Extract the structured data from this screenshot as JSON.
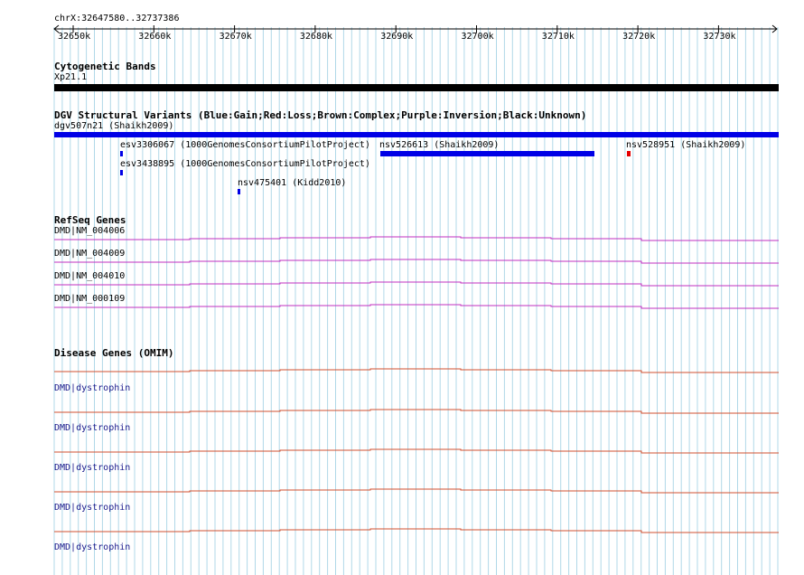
{
  "colors": {
    "grid": "#b0d8e8",
    "gain": "#0000e6",
    "loss": "#e60000",
    "band": "#000000",
    "refseq_line": "#c030c0",
    "omim_line": "#d05030",
    "omim_label": "#1a1a8c"
  },
  "ruler": {
    "location": "chrX:32647580..32737386",
    "ticks": [
      "32650k",
      "32660k",
      "32670k",
      "32680k",
      "32690k",
      "32700k",
      "32710k",
      "32720k",
      "32730k"
    ]
  },
  "cytoband": {
    "title": "Cytogenetic Bands",
    "band_label": "Xp21.1"
  },
  "dgv": {
    "title": "DGV Structural Variants (Blue:Gain;Red:Loss;Brown:Complex;Purple:Inversion;Black:Unknown)",
    "features": [
      {
        "label": "dgv507n21 (Shaikh2009)",
        "type": "gain"
      },
      {
        "label": "esv3306067 (1000GenomesConsortiumPilotProject)",
        "type": "gain"
      },
      {
        "label": "nsv526613 (Shaikh2009)",
        "type": "gain"
      },
      {
        "label": "nsv528951 (Shaikh2009)",
        "type": "loss"
      },
      {
        "label": "esv3438895 (1000GenomesConsortiumPilotProject)",
        "type": "gain"
      },
      {
        "label": "nsv475401 (Kidd2010)",
        "type": "gain"
      }
    ]
  },
  "refseq": {
    "title": "RefSeq Genes",
    "genes": [
      {
        "label": "DMD|NM_004006"
      },
      {
        "label": "DMD|NM_004009"
      },
      {
        "label": "DMD|NM_004010"
      },
      {
        "label": "DMD|NM_000109"
      }
    ]
  },
  "omim": {
    "title": "Disease Genes (OMIM)",
    "genes": [
      {
        "label": "DMD|dystrophin"
      },
      {
        "label": "DMD|dystrophin"
      },
      {
        "label": "DMD|dystrophin"
      },
      {
        "label": "DMD|dystrophin"
      },
      {
        "label": "DMD|dystrophin"
      }
    ]
  }
}
